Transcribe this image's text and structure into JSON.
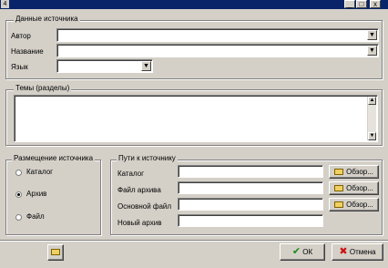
{
  "window": {
    "title_icon": "4",
    "min_glyph": "_",
    "max_glyph": "□",
    "close_glyph": "x"
  },
  "source": {
    "legend": "Данные источника",
    "author_label": "Автор",
    "name_label": "Название",
    "lang_label": "Язык",
    "author_value": "",
    "name_value": "",
    "lang_value": "",
    "dropdown_glyph": "▼"
  },
  "topics": {
    "legend": "Темы (разделы)",
    "value": "",
    "scroll_up": "▲",
    "scroll_down": "▼"
  },
  "placement": {
    "legend": "Размещение источника",
    "options": [
      {
        "label": "Каталог",
        "selected": false
      },
      {
        "label": "Архив",
        "selected": true
      },
      {
        "label": "Файл",
        "selected": false
      }
    ]
  },
  "paths": {
    "legend": "Пути к источнику",
    "rows": [
      {
        "label": "Каталог",
        "value": "",
        "browse": "Обзор..."
      },
      {
        "label": "Файл архива",
        "value": "",
        "browse": "Обзор..."
      },
      {
        "label": "Основной файл",
        "value": "",
        "browse": "Обзор..."
      },
      {
        "label": "Новый архив",
        "value": ""
      }
    ]
  },
  "footer": {
    "ok_label": "ОК",
    "cancel_label": "Отмена",
    "ok_glyph": "✔",
    "cancel_glyph": "✖"
  },
  "colors": {
    "titlebar": "#0a246a",
    "face": "#d4d0c8",
    "ok_check": "#1a8a1a",
    "cancel_x": "#cc1111"
  }
}
